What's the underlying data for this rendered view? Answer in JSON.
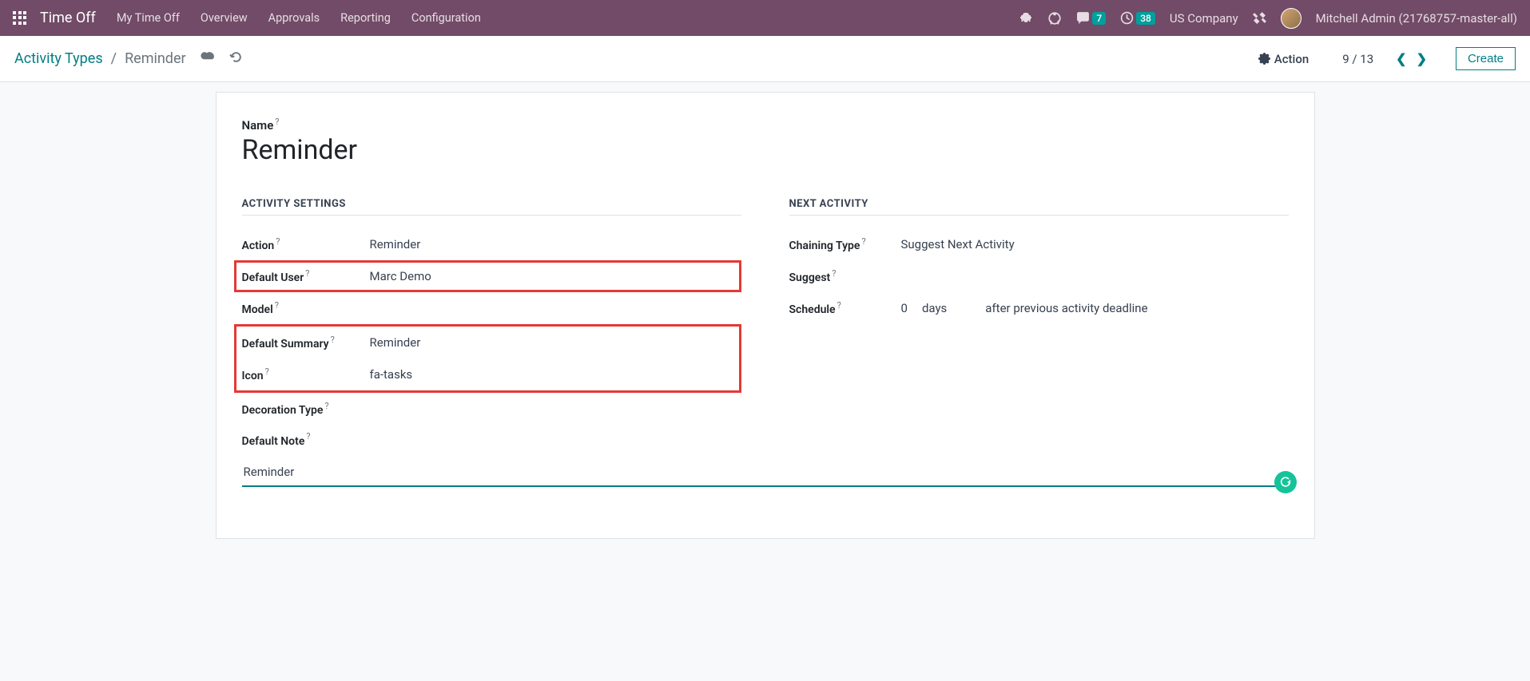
{
  "navbar": {
    "brand": "Time Off",
    "links": [
      "My Time Off",
      "Overview",
      "Approvals",
      "Reporting",
      "Configuration"
    ],
    "messages_count": "7",
    "activities_count": "38",
    "company": "US Company",
    "user": "Mitchell Admin (21768757-master-all)"
  },
  "breadcrumb": {
    "parent": "Activity Types",
    "current": "Reminder"
  },
  "control": {
    "action_label": "Action",
    "pager": "9 / 13",
    "create_label": "Create"
  },
  "form": {
    "name_label": "Name",
    "name_value": "Reminder",
    "section_activity": "ACTIVITY SETTINGS",
    "section_next": "NEXT ACTIVITY",
    "fields": {
      "action_label": "Action",
      "action_value": "Reminder",
      "default_user_label": "Default User",
      "default_user_value": "Marc Demo",
      "model_label": "Model",
      "model_value": "",
      "default_summary_label": "Default Summary",
      "default_summary_value": "Reminder",
      "icon_label": "Icon",
      "icon_value": "fa-tasks",
      "decoration_label": "Decoration Type",
      "decoration_value": "",
      "default_note_label": "Default Note",
      "default_note_value": "Reminder",
      "chaining_label": "Chaining Type",
      "chaining_value": "Suggest Next Activity",
      "suggest_label": "Suggest",
      "suggest_value": "",
      "schedule_label": "Schedule",
      "schedule_count": "0",
      "schedule_unit": "days",
      "schedule_desc": "after previous activity deadline"
    }
  }
}
